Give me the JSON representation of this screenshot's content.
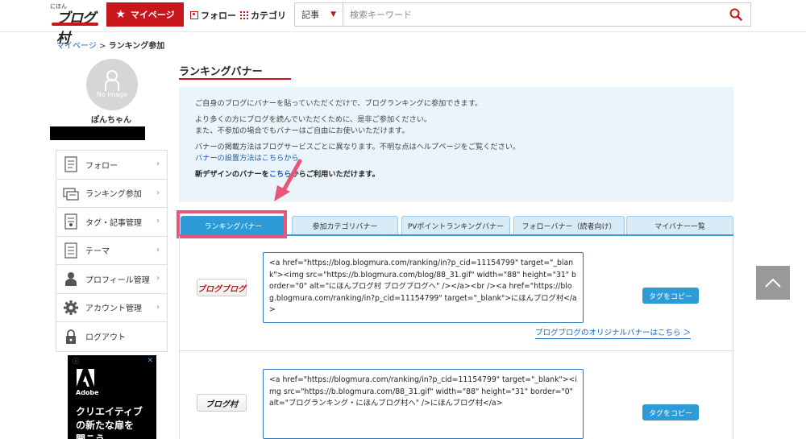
{
  "header": {
    "logo_small": "にほん",
    "logo_text": "ブログ村",
    "mypage_label": "マイページ",
    "follow_label": "フォロー",
    "category_label": "カテゴリ",
    "search_select": "記事",
    "search_placeholder": "検索キーワード"
  },
  "breadcrumb": {
    "link": "マイページ",
    "separator": ">",
    "current": "ランキング参加"
  },
  "profile": {
    "avatar_text": "No image",
    "username": "ぽんちゃん"
  },
  "sidebar": {
    "items": [
      {
        "label": "フォロー",
        "icon": "follow-list-icon"
      },
      {
        "label": "ランキング参加",
        "icon": "ranking-icon"
      },
      {
        "label": "タグ・記事管理",
        "icon": "tag-article-icon"
      },
      {
        "label": "テーマ",
        "icon": "theme-icon"
      },
      {
        "label": "プロフィール管理",
        "icon": "profile-icon"
      },
      {
        "label": "アカウント管理",
        "icon": "gear-icon"
      },
      {
        "label": "ログアウト",
        "icon": "lock-icon"
      }
    ]
  },
  "ad": {
    "brand": "Adobe",
    "text": "クリエイティブ\nの新たな扉を\n開こう"
  },
  "main": {
    "title": "ランキングバナー",
    "info": {
      "line1": "ご自身のブログにバナーを貼っていただくだけで、ブログランキングに参加できます。",
      "line2": "より多くの方にブログを読んでいただくために、是非ご参加ください。",
      "line3": "また、不参加の場合でもバナーはご自由にお使いいただけます。",
      "line4": "バナーの掲載方法はブログサービスごとに異なります。不明な点はヘルプページをご覧ください。",
      "link1": "バナーの設置方法はこちらから",
      "line5_pre": "新デザインのバナーを",
      "line5_link": "こちら",
      "line5_post": "からご利用いただけます。"
    },
    "tabs": [
      {
        "label": "ランキングバナー"
      },
      {
        "label": "参加カテゴリバナー"
      },
      {
        "label": "PVポイントランキングバナー"
      },
      {
        "label": "フォローバナー（読者向け）"
      },
      {
        "label": "マイバナー一覧"
      }
    ],
    "banners": [
      {
        "banner_text": "ブログブログ",
        "code": "<a href=\"https://blog.blogmura.com/ranking/in?p_cid=11154799\" target=\"_blank\"><img src=\"https://b.blogmura.com/blog/88_31.gif\" width=\"88\" height=\"31\" border=\"0\" alt=\"にほんブログ村 ブログブログへ\" /></a><br /><a href=\"https://blog.blogmura.com/ranking/in?p_cid=11154799\" target=\"_blank\">にほんブログ村</a>",
        "copy_label": "タグをコピー",
        "link_text": "ブログブログのオリジナルバナーはこちら ＞"
      },
      {
        "banner_text": "ブログ村",
        "code": "<a href=\"https://blogmura.com/ranking/in?p_cid=11154799\" target=\"_blank\"><img src=\"https://b.blogmura.com/88_31.gif\" width=\"88\" height=\"31\" border=\"0\" alt=\"ブログランキング・にほんブログ村へ\" />にほんブログ村</a>",
        "copy_label": "タグをコピー"
      }
    ]
  },
  "colors": {
    "brand_red": "#c8161d",
    "tab_blue": "#2e9bd6",
    "highlight_pink": "#e9567b",
    "info_bg": "#ebf4fa"
  }
}
